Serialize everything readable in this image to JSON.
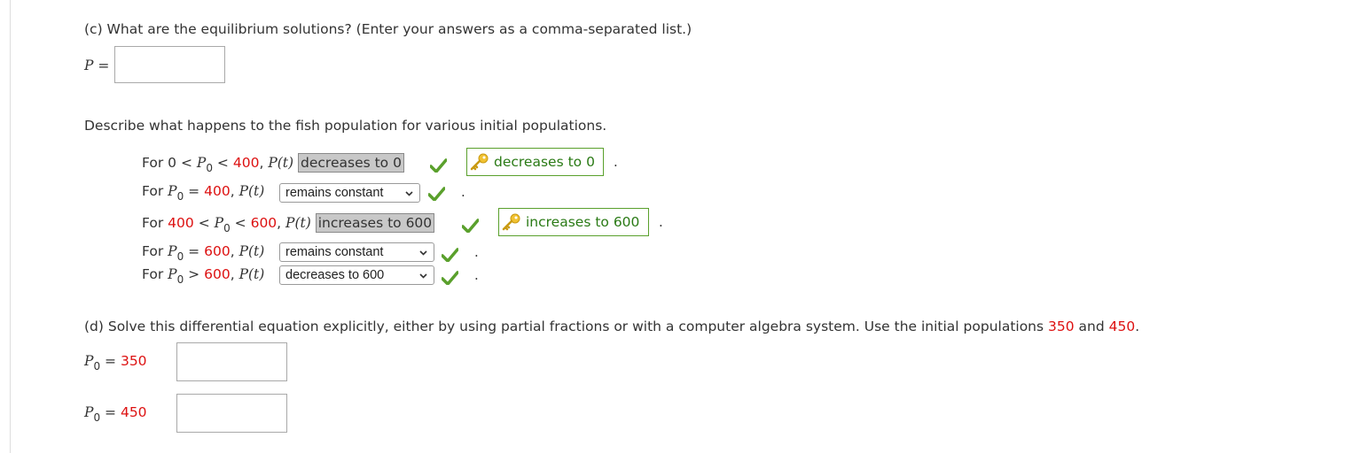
{
  "part_c": {
    "question": "(c) What are the equilibrium solutions? (Enter your answers as a comma-separated list.)",
    "p_label": "P",
    "eq": "=",
    "p_value": ""
  },
  "describe": {
    "prompt": "Describe what happens to the fish population for various initial populations.",
    "rows": [
      {
        "lo": "0",
        "hi": "400",
        "shown": "decreases to 0",
        "key": "decreases to 0"
      },
      {
        "val": "400",
        "selected": "remains constant"
      },
      {
        "lo": "400",
        "hi": "600",
        "shown": "increases to 600",
        "key": "increases to 600"
      },
      {
        "val": "600",
        "selected": "remains constant"
      },
      {
        "val": "600",
        "selected": "decreases to 600"
      }
    ],
    "for_word": "For",
    "pt": "P(t)",
    "p": "P",
    "sub0": "0",
    "lt": "<",
    "gt": ">",
    "eq": "=",
    "comma": ",",
    "period": "."
  },
  "part_d": {
    "question_start": "(d) Solve this differential equation explicitly, either by using partial fractions or with a computer algebra system. Use the initial populations ",
    "v1": "350",
    "and": " and ",
    "v2": "450",
    "end": ".",
    "p0_a_value": "350",
    "p0_b_value": "450",
    "answer_a": "",
    "answer_b": ""
  },
  "colors": {
    "red": "#dd1111",
    "green_check": "#5aa02c",
    "key_text": "#2a7a15",
    "shown_answer_bg": "#c8c8c8"
  },
  "icons": [
    "check-icon",
    "key-icon",
    "chevron-down-icon"
  ]
}
